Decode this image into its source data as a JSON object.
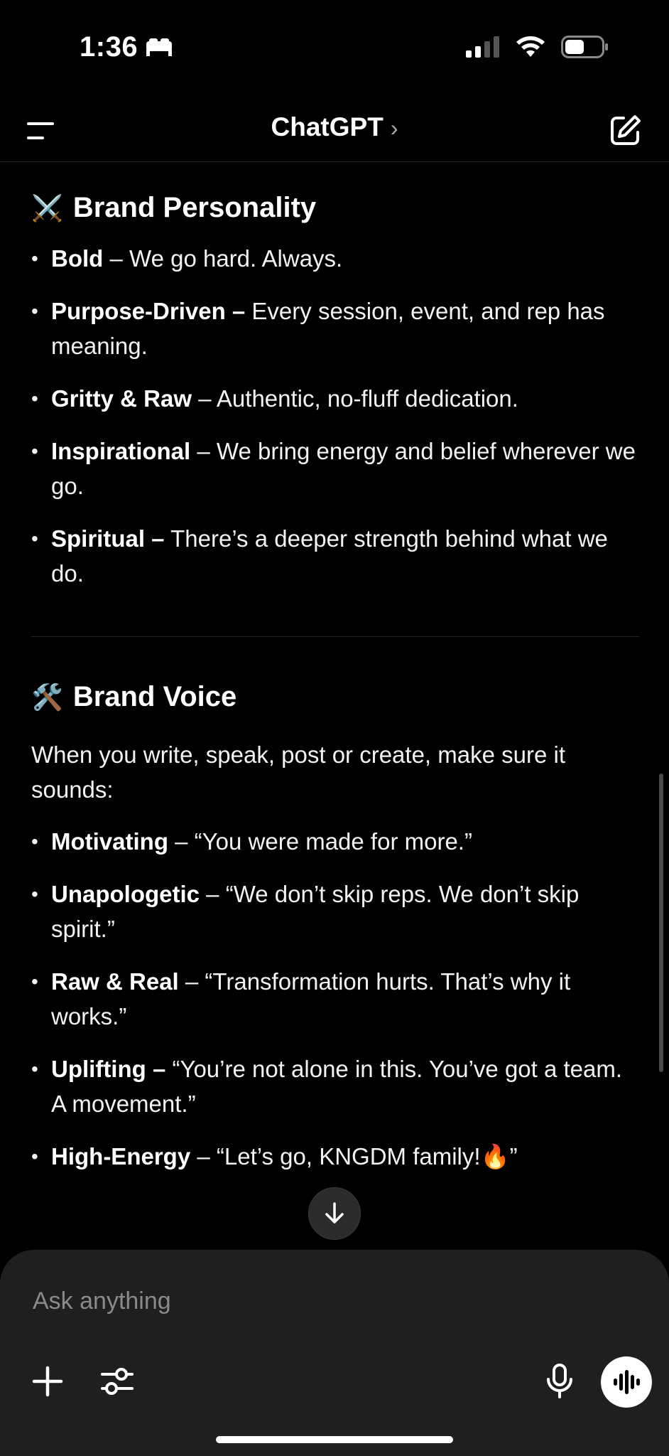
{
  "status_bar": {
    "time": "1:36",
    "sleep_icon": "bed-icon",
    "signal_icon": "cellular-signal-icon",
    "wifi_icon": "wifi-icon",
    "battery_icon": "battery-icon"
  },
  "header": {
    "title": "ChatGPT",
    "chevron": "›",
    "menu_icon": "menu-icon",
    "compose_icon": "compose-icon"
  },
  "sections": {
    "personality": {
      "emoji": "⚔️",
      "title": "Brand Personality",
      "items": [
        {
          "bold": "Bold",
          "text": " – We go hard. Always."
        },
        {
          "bold": "Purpose-Driven –",
          "text": " Every session, event, and rep has meaning."
        },
        {
          "bold": "Gritty & Raw",
          "text": " – Authentic, no-fluff dedication."
        },
        {
          "bold": "Inspirational",
          "text": " – We bring energy and belief wherever we go."
        },
        {
          "bold": "Spiritual –",
          "text": " There’s a deeper strength behind what we do."
        }
      ]
    },
    "voice": {
      "emoji": "🛠️",
      "title": "Brand Voice",
      "intro": "When you write, speak, post or create, make sure it sounds:",
      "items": [
        {
          "bold": "Motivating",
          "text": " – “You were made for more.”"
        },
        {
          "bold": "Unapologetic",
          "text": " – “We don’t skip reps. We don’t skip spirit.”"
        },
        {
          "bold": "Raw & Real",
          "text": " – “Transformation hurts. That’s why it works.”"
        },
        {
          "bold": "Uplifting –",
          "text": " “You’re not alone in this. You’ve got a team. A movement.”"
        },
        {
          "bold": "High-Energy",
          "text": " – “Let’s go, KNGDM family!🔥”"
        }
      ]
    }
  },
  "composer": {
    "placeholder": "Ask anything",
    "plus_icon": "plus-icon",
    "tools_icon": "sliders-icon",
    "mic_icon": "microphone-icon",
    "voice_icon": "voice-mode-icon"
  },
  "scroll_down_icon": "arrow-down-icon"
}
